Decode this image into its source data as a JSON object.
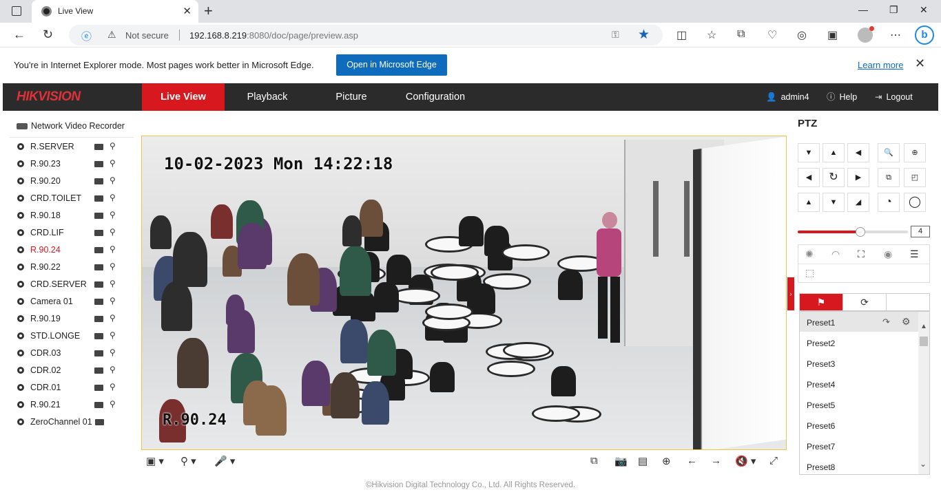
{
  "browser": {
    "tab_title": "Live View",
    "url_warning": "Not secure",
    "url_host": "192.168.8.219",
    "url_rest": ":8080/doc/page/preview.asp",
    "ie_message": "You're in Internet Explorer mode. Most pages work better in Microsoft Edge.",
    "open_edge_label": "Open in Microsoft Edge",
    "learn_more_label": "Learn more"
  },
  "app": {
    "logo": "HIKVISION",
    "menu": [
      "Live View",
      "Playback",
      "Picture",
      "Configuration"
    ],
    "active_menu": "Live View",
    "user": "admin4",
    "help_label": "Help",
    "logout_label": "Logout"
  },
  "device_tree": {
    "root": "Network Video Recorder",
    "cameras": [
      "R.SERVER",
      "R.90.23",
      "R.90.20",
      "CRD.TOILET",
      "R.90.18",
      "CRD.LIF",
      "R.90.24",
      "R.90.22",
      "CRD.SERVER",
      "Camera 01",
      "R.90.19",
      "STD.LONGE",
      "CDR.03",
      "CDR.02",
      "CDR.01",
      "R.90.21",
      "ZeroChannel 01"
    ],
    "selected": "R.90.24"
  },
  "video": {
    "osd_datetime": "10-02-2023 Mon 14:22:18",
    "osd_camera": "R.90.24"
  },
  "footer": "©Hikvision Digital Technology Co., Ltd. All Rights Reserved.",
  "ptz": {
    "title": "PTZ",
    "speed": "4",
    "speed_fraction": 0.57,
    "presets": [
      "Preset1",
      "Preset2",
      "Preset3",
      "Preset4",
      "Preset5",
      "Preset6",
      "Preset7",
      "Preset8"
    ],
    "selected_preset": "Preset1"
  },
  "colors": {
    "brand_red": "#d7191f",
    "header_bg": "#2b2b2b",
    "edge_blue": "#0f6cbd"
  }
}
